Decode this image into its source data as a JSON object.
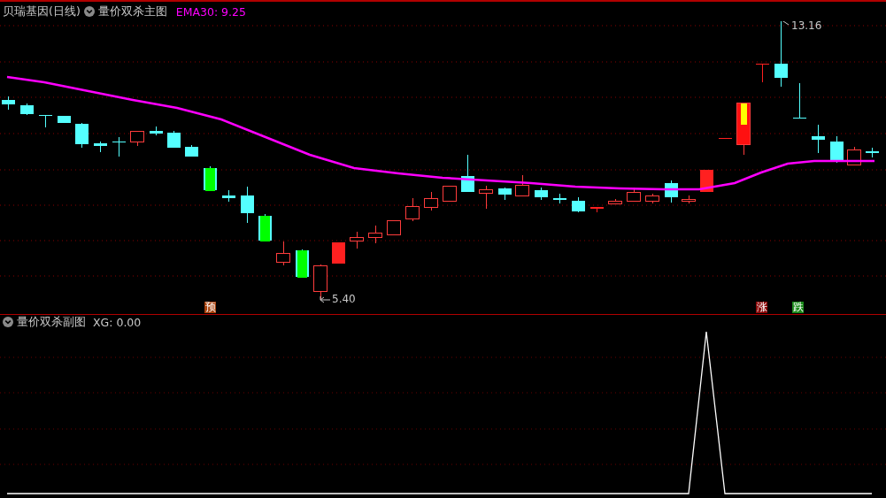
{
  "main_panel": {
    "stock_name": "贝瑞基因(日线)",
    "indicator": "量价双杀主图",
    "ema_label": "EMA30: 9.25",
    "high_label": "13.16",
    "low_label": "5.40",
    "signals": [
      {
        "text": "预",
        "color": "#a8410c"
      },
      {
        "text": "涨",
        "color": "#8a0a0a"
      },
      {
        "text": "跌",
        "color": "#1a8a1a"
      }
    ]
  },
  "sub_panel": {
    "indicator": "量价双杀副图",
    "value_label": "XG: 0.00"
  }
}
